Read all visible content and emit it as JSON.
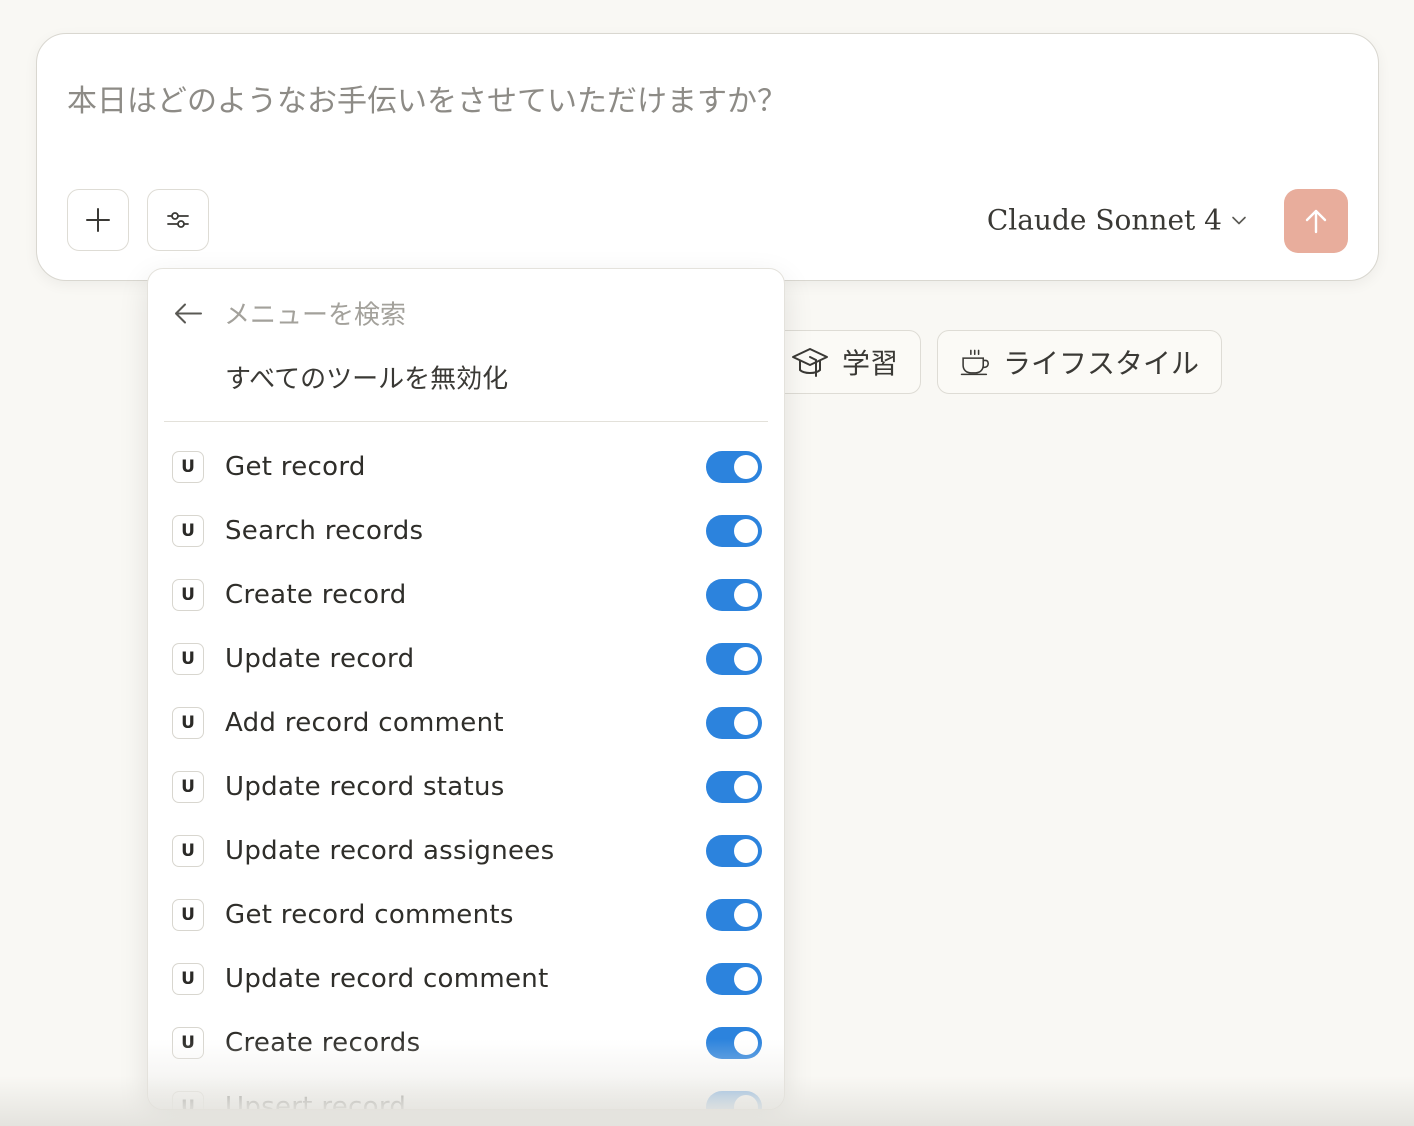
{
  "composer": {
    "placeholder": "本日はどのようなお手伝いをさせていただけますか？",
    "model_name": "Claude Sonnet 4",
    "icons": {
      "add": "plus-icon",
      "tools": "sliders-icon",
      "model_menu": "chevron-down-icon",
      "send": "arrow-up-icon"
    },
    "send_color": "#e8ad9c"
  },
  "chips": [
    {
      "label": "学習",
      "icon": "graduation-cap-icon"
    },
    {
      "label": "ライフスタイル",
      "icon": "coffee-cup-icon"
    }
  ],
  "menu": {
    "search_placeholder": "メニューを検索",
    "back_icon": "arrow-left-icon",
    "disable_all_label": "すべてのツールを無効化",
    "toggle_color": "#2c83dd",
    "tools": [
      {
        "badge": "U",
        "label": "Get record",
        "enabled": true
      },
      {
        "badge": "U",
        "label": "Search records",
        "enabled": true
      },
      {
        "badge": "U",
        "label": "Create record",
        "enabled": true
      },
      {
        "badge": "U",
        "label": "Update record",
        "enabled": true
      },
      {
        "badge": "U",
        "label": "Add record comment",
        "enabled": true
      },
      {
        "badge": "U",
        "label": "Update record status",
        "enabled": true
      },
      {
        "badge": "U",
        "label": "Update record assignees",
        "enabled": true
      },
      {
        "badge": "U",
        "label": "Get record comments",
        "enabled": true
      },
      {
        "badge": "U",
        "label": "Update record comment",
        "enabled": true
      },
      {
        "badge": "U",
        "label": "Create records",
        "enabled": true
      },
      {
        "badge": "U",
        "label": "Upsert record",
        "enabled": true
      }
    ]
  }
}
